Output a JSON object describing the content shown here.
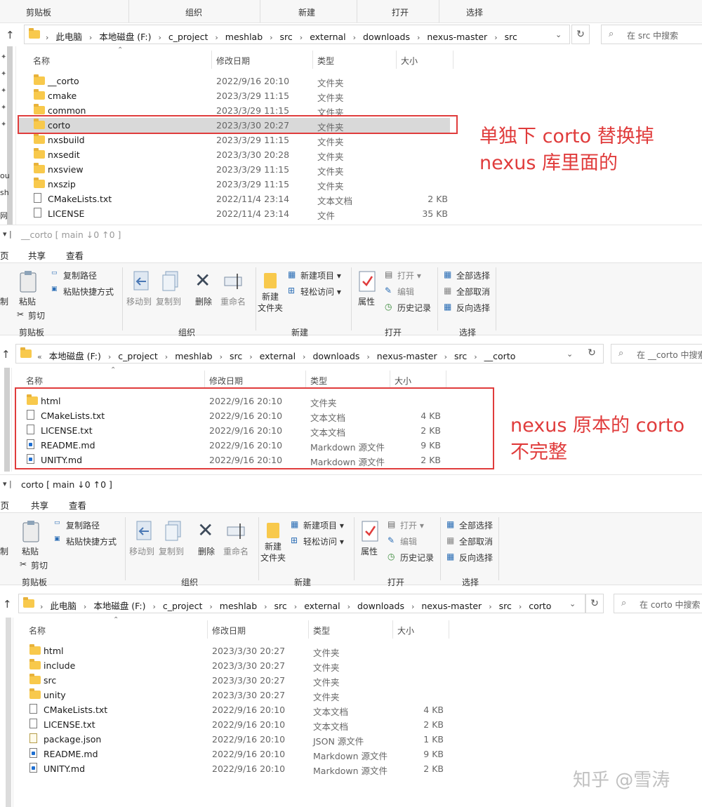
{
  "colors": {
    "accent_red": "#e03c3c",
    "folder_yellow": "#f8c94c",
    "selection_gray": "#d9d9d9"
  },
  "panel1": {
    "ribbon_groups": [
      "剪贴板",
      "组织",
      "新建",
      "打开",
      "选择"
    ],
    "breadcrumb": [
      "此电脑",
      "本地磁盘 (F:)",
      "c_project",
      "meshlab",
      "src",
      "external",
      "downloads",
      "nexus-master",
      "src"
    ],
    "search_placeholder": "在 src 中搜索",
    "columns": {
      "name": "名称",
      "date": "修改日期",
      "type": "类型",
      "size": "大小"
    },
    "files": [
      {
        "name": "__corto",
        "date": "2022/9/16 20:10",
        "type": "文件夹",
        "size": "",
        "icon": "folder"
      },
      {
        "name": "cmake",
        "date": "2023/3/29 11:15",
        "type": "文件夹",
        "size": "",
        "icon": "folder"
      },
      {
        "name": "common",
        "date": "2023/3/29 11:15",
        "type": "文件夹",
        "size": "",
        "icon": "folder"
      },
      {
        "name": "corto",
        "date": "2023/3/30 20:27",
        "type": "文件夹",
        "size": "",
        "icon": "folder",
        "selected": true
      },
      {
        "name": "nxsbuild",
        "date": "2023/3/29 11:15",
        "type": "文件夹",
        "size": "",
        "icon": "folder"
      },
      {
        "name": "nxsedit",
        "date": "2023/3/30 20:28",
        "type": "文件夹",
        "size": "",
        "icon": "folder"
      },
      {
        "name": "nxsview",
        "date": "2023/3/29 11:15",
        "type": "文件夹",
        "size": "",
        "icon": "folder"
      },
      {
        "name": "nxszip",
        "date": "2023/3/29 11:15",
        "type": "文件夹",
        "size": "",
        "icon": "folder"
      },
      {
        "name": "CMakeLists.txt",
        "date": "2022/11/4 23:14",
        "type": "文本文档",
        "size": "2 KB",
        "icon": "doc"
      },
      {
        "name": "LICENSE",
        "date": "2022/11/4 23:14",
        "type": "文件",
        "size": "35 KB",
        "icon": "doc"
      }
    ],
    "nav_fragments": [
      "ou",
      "sh",
      "网"
    ],
    "annotation": [
      "单独下 corto 替换掉",
      "nexus 库里面的"
    ]
  },
  "panel2": {
    "window_title": "__corto [ main ↓0 ↑0 ]",
    "tabs": [
      "页",
      "共享",
      "查看"
    ],
    "ribbon": {
      "copy_path": "复制路径",
      "paste_shortcut": "粘贴快捷方式",
      "paste": "粘贴",
      "cut": "剪切",
      "move_to": "移动到",
      "copy_to": "复制到",
      "delete": "删除",
      "rename": "重命名",
      "new_folder": "新建\n文件夹",
      "new_item": "新建项目 ▾",
      "easy_access": "轻松访问 ▾",
      "properties": "属性",
      "open": "打开 ▾",
      "edit": "编辑",
      "history": "历史记录",
      "select_all": "全部选择",
      "select_none": "全部取消",
      "invert": "反向选择",
      "left_fragment_1": "制",
      "groups": [
        "剪贴板",
        "组织",
        "新建",
        "打开",
        "选择"
      ]
    },
    "breadcrumb": [
      "本地磁盘 (F:)",
      "c_project",
      "meshlab",
      "src",
      "external",
      "downloads",
      "nexus-master",
      "src",
      "__corto"
    ],
    "breadcrumb_prefix": "«",
    "search_placeholder": "在 __corto 中搜索",
    "columns": {
      "name": "名称",
      "date": "修改日期",
      "type": "类型",
      "size": "大小"
    },
    "files": [
      {
        "name": "html",
        "date": "2022/9/16 20:10",
        "type": "文件夹",
        "size": "",
        "icon": "folder"
      },
      {
        "name": "CMakeLists.txt",
        "date": "2022/9/16 20:10",
        "type": "文本文档",
        "size": "4 KB",
        "icon": "doc"
      },
      {
        "name": "LICENSE.txt",
        "date": "2022/9/16 20:10",
        "type": "文本文档",
        "size": "2 KB",
        "icon": "doc"
      },
      {
        "name": "README.md",
        "date": "2022/9/16 20:10",
        "type": "Markdown 源文件",
        "size": "9 KB",
        "icon": "md"
      },
      {
        "name": "UNITY.md",
        "date": "2022/9/16 20:10",
        "type": "Markdown 源文件",
        "size": "2 KB",
        "icon": "md"
      }
    ],
    "annotation": [
      "nexus 原本的 corto",
      "不完整"
    ]
  },
  "panel3": {
    "window_title": "corto [ main ↓0 ↑0 ]",
    "tabs": [
      "主页",
      "共享",
      "查看"
    ],
    "breadcrumb": [
      "此电脑",
      "本地磁盘 (F:)",
      "c_project",
      "meshlab",
      "src",
      "external",
      "downloads",
      "nexus-master",
      "src",
      "corto"
    ],
    "search_placeholder": "在 corto 中搜索",
    "columns": {
      "name": "名称",
      "date": "修改日期",
      "type": "类型",
      "size": "大小"
    },
    "files": [
      {
        "name": "html",
        "date": "2023/3/30 20:27",
        "type": "文件夹",
        "size": "",
        "icon": "folder"
      },
      {
        "name": "include",
        "date": "2023/3/30 20:27",
        "type": "文件夹",
        "size": "",
        "icon": "folder"
      },
      {
        "name": "src",
        "date": "2023/3/30 20:27",
        "type": "文件夹",
        "size": "",
        "icon": "folder"
      },
      {
        "name": "unity",
        "date": "2023/3/30 20:27",
        "type": "文件夹",
        "size": "",
        "icon": "folder"
      },
      {
        "name": "CMakeLists.txt",
        "date": "2022/9/16 20:10",
        "type": "文本文档",
        "size": "4 KB",
        "icon": "doc"
      },
      {
        "name": "LICENSE.txt",
        "date": "2022/9/16 20:10",
        "type": "文本文档",
        "size": "2 KB",
        "icon": "doc"
      },
      {
        "name": "package.json",
        "date": "2022/9/16 20:10",
        "type": "JSON 源文件",
        "size": "1 KB",
        "icon": "json"
      },
      {
        "name": "README.md",
        "date": "2022/9/16 20:10",
        "type": "Markdown 源文件",
        "size": "9 KB",
        "icon": "md"
      },
      {
        "name": "UNITY.md",
        "date": "2022/9/16 20:10",
        "type": "Markdown 源文件",
        "size": "2 KB",
        "icon": "md"
      }
    ]
  },
  "watermark": "知乎 @雪涛"
}
